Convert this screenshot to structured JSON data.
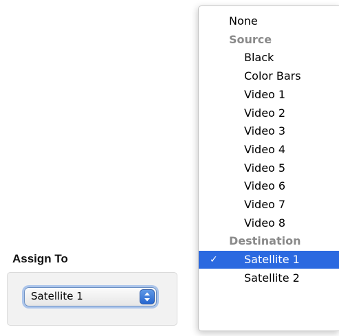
{
  "assign": {
    "label": "Assign To",
    "selected_value": "Satellite 1"
  },
  "menu": {
    "items": [
      {
        "label": "None",
        "type": "item"
      },
      {
        "label": "Source",
        "type": "header"
      },
      {
        "label": "Black",
        "type": "item"
      },
      {
        "label": "Color Bars",
        "type": "item"
      },
      {
        "label": "Video 1",
        "type": "item"
      },
      {
        "label": "Video 2",
        "type": "item"
      },
      {
        "label": "Video 3",
        "type": "item"
      },
      {
        "label": "Video 4",
        "type": "item"
      },
      {
        "label": "Video 5",
        "type": "item"
      },
      {
        "label": "Video 6",
        "type": "item"
      },
      {
        "label": "Video 7",
        "type": "item"
      },
      {
        "label": "Video 8",
        "type": "item"
      },
      {
        "label": "Destination",
        "type": "header"
      },
      {
        "label": "Satellite 1",
        "type": "item",
        "selected": true
      },
      {
        "label": "Satellite 2",
        "type": "item"
      }
    ],
    "checkmark": "✓",
    "highlight_color": "#2b69e0"
  },
  "icons": {
    "stepper": "up-down-arrows-icon",
    "check": "checkmark-icon"
  }
}
